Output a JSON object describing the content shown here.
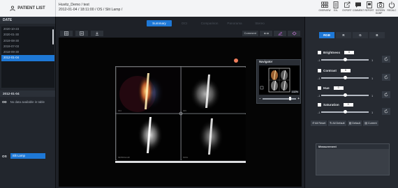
{
  "header": {
    "patient_list_label": "PATIENT LIST",
    "study_line1": "Huvitz_Demo / test",
    "study_line2": "2012-01-04 / 18:11:00 / OS / Slit Lamp /",
    "tools": [
      {
        "icon": "overview-grid-icon",
        "label": "OVERVIEW"
      },
      {
        "icon": "document-icon",
        "label": "EXL"
      },
      {
        "icon": "export-icon",
        "label": "EXPORT"
      },
      {
        "icon": "comment-icon",
        "label": "COMMENT"
      },
      {
        "icon": "report-icon",
        "label": "REPORT"
      },
      {
        "icon": "screenshot-icon",
        "label": "SCREEN DUMP"
      },
      {
        "icon": "power-icon",
        "label": "RECALC"
      }
    ]
  },
  "sidebar": {
    "date_header": "DATE",
    "dates": [
      "2020-10-23",
      "2020-01-30",
      "2019-08-30",
      "2019-07-03",
      "2018-09-30",
      "2012-01-04"
    ],
    "selected_date_index": 5,
    "selected_date_label": "2012-01-04",
    "eye_label": "OD",
    "no_data_text": "No data available in table",
    "os_label": "OS",
    "os_item": "Slit Lamp"
  },
  "center": {
    "tabs": [
      "Summary",
      "OCI",
      "Comparison",
      "Panorama",
      "Stereo"
    ],
    "active_tab_index": 0,
    "comment_label": "Comment",
    "quad_labels": [
      "D44",
      "D45",
      "RETROILLUM",
      "NOOL"
    ]
  },
  "navigator": {
    "title": "Navigator",
    "zoom": "102%",
    "minus": "−",
    "plus": "+",
    "zoom_level": 0.83
  },
  "right_panel": {
    "channel_tabs": [
      "RGB",
      "R",
      "G",
      "B"
    ],
    "active_channel_index": 0,
    "adjustments": [
      {
        "label": "Brightness",
        "value": "0",
        "min": "-1",
        "max": "1"
      },
      {
        "label": "Contrast",
        "value": "0",
        "min": "-1",
        "max": "1"
      },
      {
        "label": "Hue",
        "value": "0",
        "min": "-1",
        "max": "1"
      },
      {
        "label": "Saturation",
        "value": "0",
        "min": "-1",
        "max": "1"
      }
    ],
    "buttons": [
      "All Reset",
      "All Default",
      "Default",
      "Current"
    ],
    "measurement_title": "Measurement"
  }
}
